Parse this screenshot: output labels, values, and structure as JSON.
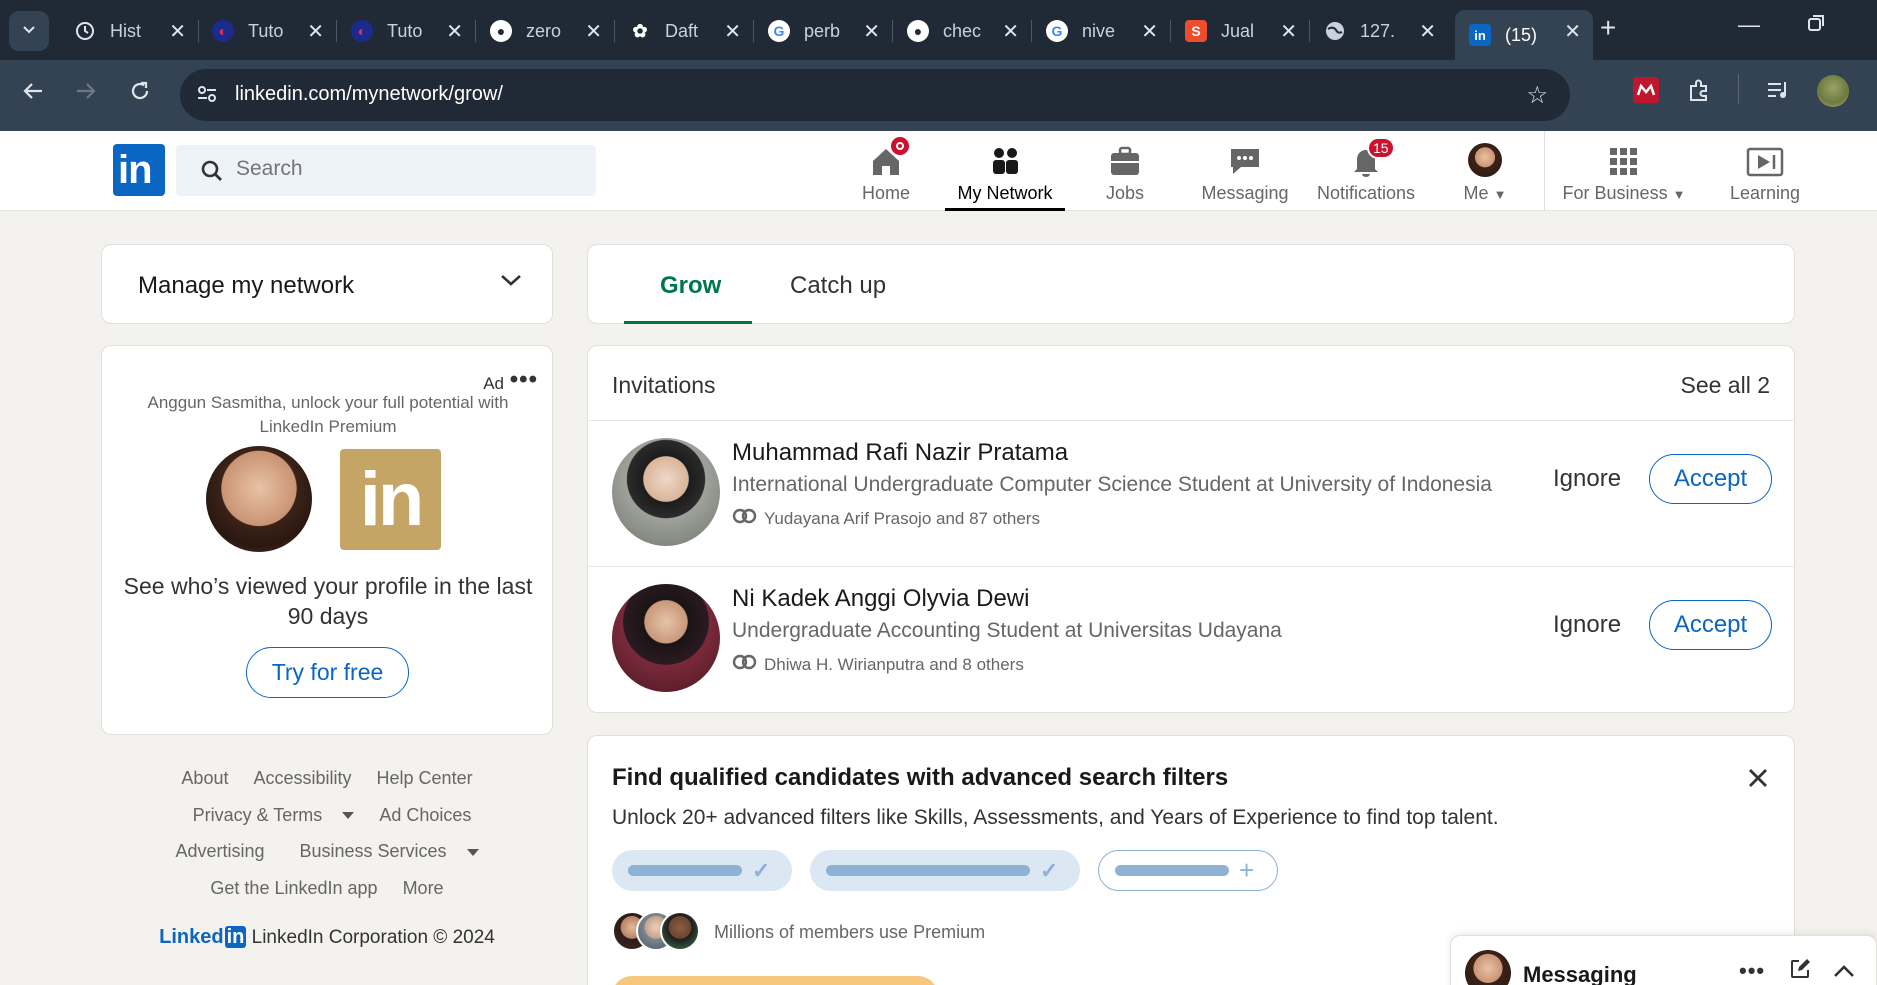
{
  "browser": {
    "tabs": [
      {
        "title": "Hist",
        "icon": "history-icon"
      },
      {
        "title": "Tuto",
        "icon": "site-icon"
      },
      {
        "title": "Tuto",
        "icon": "site-icon"
      },
      {
        "title": "zero",
        "icon": "github-icon"
      },
      {
        "title": "Daft",
        "icon": "chatgpt-icon"
      },
      {
        "title": "perb",
        "icon": "google-icon"
      },
      {
        "title": "chec",
        "icon": "github-icon"
      },
      {
        "title": "nive",
        "icon": "google-icon"
      },
      {
        "title": "Jual",
        "icon": "shopee-icon"
      },
      {
        "title": "127.",
        "icon": "globe-icon"
      },
      {
        "title": "(15)",
        "icon": "linkedin-icon"
      }
    ],
    "url": "linkedin.com/mynetwork/grow/"
  },
  "header": {
    "search_placeholder": "Search",
    "nav": {
      "home": "Home",
      "my_network": "My Network",
      "jobs": "Jobs",
      "messaging": "Messaging",
      "notifications": "Notifications",
      "notifications_count": "15",
      "me": "Me",
      "for_business": "For Business",
      "learning": "Learning"
    }
  },
  "sidebar": {
    "manage_title": "Manage my network",
    "ad": {
      "label": "Ad",
      "promo": "Anggun Sasmitha, unlock your full potential with LinkedIn Premium",
      "premium_logo": "in",
      "headline": "See who’s viewed your profile in the last 90 days",
      "cta": "Try for free"
    },
    "footer": {
      "about": "About",
      "accessibility": "Accessibility",
      "help_center": "Help Center",
      "privacy_terms": "Privacy & Terms",
      "ad_choices": "Ad Choices",
      "advertising": "Advertising",
      "business_services": "Business Services",
      "get_app": "Get the LinkedIn app",
      "more": "More",
      "wordmark_text": "Linked",
      "wordmark_box": "in",
      "copyright": "LinkedIn Corporation © 2024"
    }
  },
  "main": {
    "tabs": {
      "grow": "Grow",
      "catch_up": "Catch up"
    },
    "invitations": {
      "title": "Invitations",
      "see_all": "See all 2",
      "items": [
        {
          "name": "Muhammad Rafi Nazir Pratama",
          "headline": "International Undergraduate Computer Science Student at University of Indonesia",
          "mutual": "Yudayana Arif Prasojo and 87 others",
          "ignore": "Ignore",
          "accept": "Accept"
        },
        {
          "name": "Ni Kadek Anggi Olyvia Dewi",
          "headline": "Undergraduate Accounting Student at Universitas Udayana",
          "mutual": "Dhiwa H. Wirianputra and 8 others",
          "ignore": "Ignore",
          "accept": "Accept"
        }
      ]
    },
    "promo": {
      "title": "Find qualified candidates with advanced search filters",
      "subtitle": "Unlock 20+ advanced filters like Skills, Assessments, and Years of Experience to find top talent.",
      "members": "Millions of members use Premium"
    }
  },
  "messaging": {
    "title": "Messaging"
  },
  "colors": {
    "brand": "#0a66c2",
    "grow_green": "#01754f",
    "badge_red": "#cb112d",
    "premium_gold": "#c4a565"
  }
}
